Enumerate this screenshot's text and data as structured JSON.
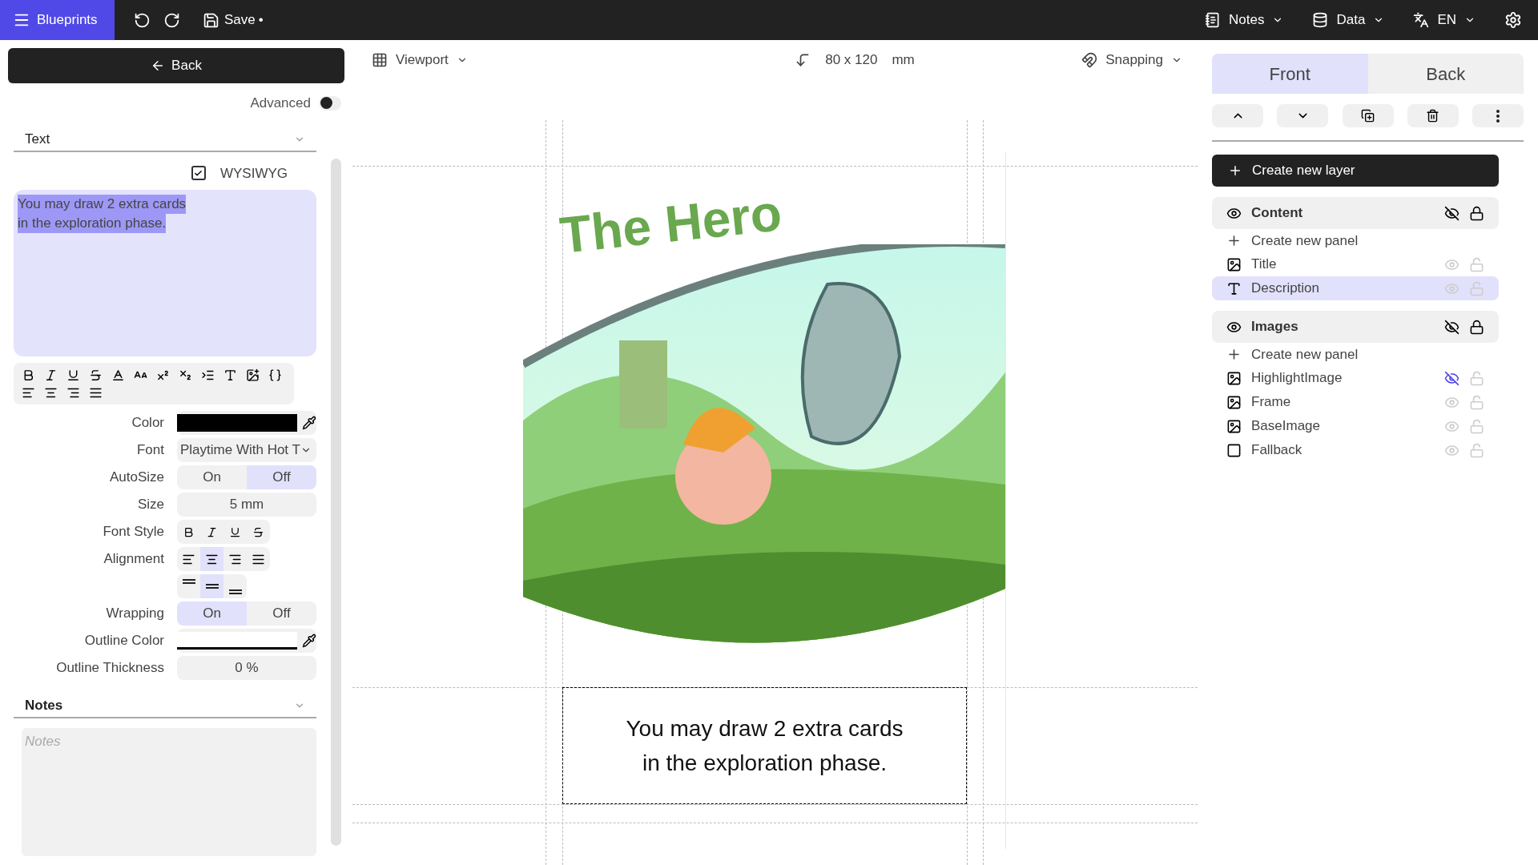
{
  "topbar": {
    "menu_button": "Blueprints",
    "save": {
      "label": "Save",
      "marker": "•"
    },
    "menus": [
      {
        "kind": "notes",
        "label": "Notes"
      },
      {
        "kind": "data",
        "label": "Data"
      },
      {
        "kind": "language",
        "label": "EN"
      }
    ]
  },
  "left": {
    "back": "Back",
    "advanced": {
      "label": "Advanced",
      "on": false
    },
    "text_section": {
      "title": "Text",
      "expanded": true,
      "wysiwyg": {
        "label": "WYSIWYG",
        "checked": true
      },
      "editor": {
        "lines": [
          "You may draw 2 extra cards",
          "in the exploration phase."
        ],
        "selected": true
      }
    },
    "properties": [
      {
        "kind": "swatch",
        "label": "Color",
        "color": "#000000"
      },
      {
        "kind": "select",
        "label": "Font",
        "value": "Playtime With Hot T"
      },
      {
        "kind": "segmented",
        "label": "AutoSize",
        "options": [
          {
            "label": "On",
            "selected": false
          },
          {
            "label": "Off",
            "selected": true
          }
        ]
      },
      {
        "kind": "input",
        "label": "Size",
        "value": "5 mm"
      },
      {
        "kind": "styles",
        "label": "Font Style",
        "buttons": [
          {
            "selected": false
          },
          {
            "selected": false
          },
          {
            "selected": false
          },
          {
            "selected": false
          }
        ]
      },
      {
        "kind": "align",
        "label": "Alignment",
        "horizontal": [
          {
            "selected": false
          },
          {
            "selected": true
          },
          {
            "selected": false
          },
          {
            "selected": false
          }
        ],
        "vertical": [
          {
            "selected": false
          },
          {
            "selected": true
          },
          {
            "selected": false
          }
        ]
      },
      {
        "kind": "segmented",
        "label": "Wrapping",
        "options": [
          {
            "label": "On",
            "selected": true
          },
          {
            "label": "Off",
            "selected": false
          }
        ]
      },
      {
        "kind": "swatch",
        "label": "Outline Color",
        "color": "#ffffff"
      },
      {
        "kind": "input",
        "label": "Outline Thickness",
        "value": "0 %"
      }
    ],
    "notes_section": {
      "title": "Notes",
      "expanded": true,
      "placeholder": "Notes"
    }
  },
  "canvas": {
    "viewport": "Viewport",
    "size": "80 x 120",
    "unit": "mm",
    "snapping": "Snapping",
    "card": {
      "title": "The Hero",
      "description": [
        "You may draw 2 extra cards",
        "in the exploration phase."
      ]
    }
  },
  "right": {
    "tabs": [
      {
        "label": "Front",
        "selected": true
      },
      {
        "label": "Back",
        "selected": false
      }
    ],
    "create_layer": "Create new layer",
    "layers": [
      {
        "name": "Content",
        "create_panel": "Create new panel",
        "panels": [
          {
            "kind": "image",
            "name": "Title",
            "selected": false,
            "hidden": false
          },
          {
            "kind": "text",
            "name": "Description",
            "selected": true,
            "hidden": false
          }
        ]
      },
      {
        "name": "Images",
        "create_panel": "Create new panel",
        "panels": [
          {
            "kind": "image",
            "name": "HighlightImage",
            "selected": false,
            "hidden": true
          },
          {
            "kind": "image",
            "name": "Frame",
            "selected": false,
            "hidden": false
          },
          {
            "kind": "image",
            "name": "BaseImage",
            "selected": false,
            "hidden": false
          },
          {
            "kind": "empty",
            "name": "Fallback",
            "selected": false,
            "hidden": false
          }
        ]
      }
    ]
  }
}
